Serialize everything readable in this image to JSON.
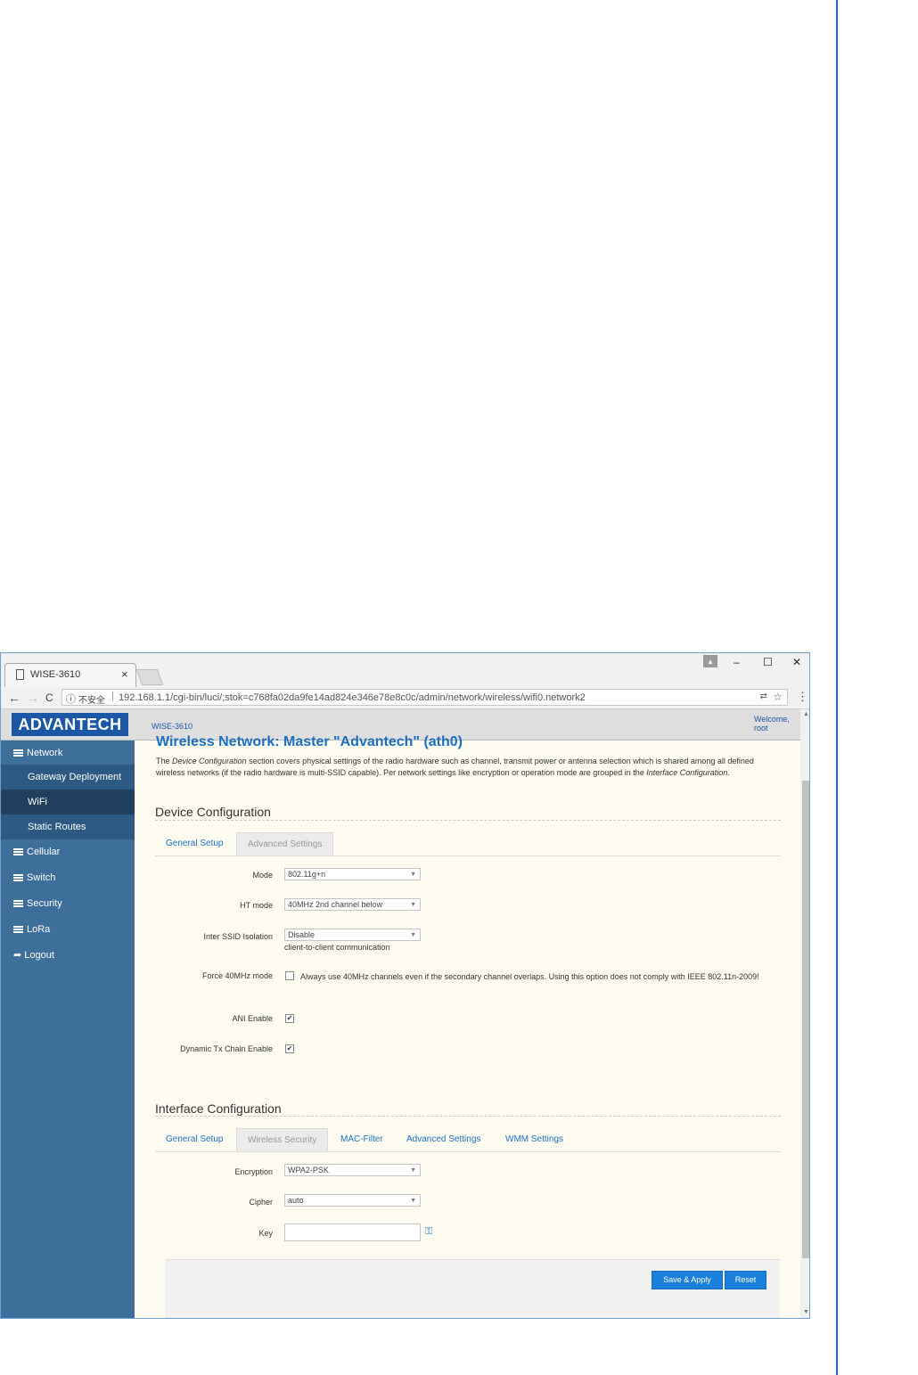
{
  "browser": {
    "tab_title": "WISE-3610",
    "tab_close": "×",
    "window_controls": {
      "minimize": "–",
      "maximize": "☐",
      "close": "✕"
    },
    "nav": {
      "back": "←",
      "forward": "→",
      "reload": "C"
    },
    "security_label": "不安全",
    "url": "192.168.1.1/cgi-bin/luci/;stok=c768fa02da9fe14ad824e346e78e8c0c/admin/network/wireless/wifi0.network2",
    "icons": [
      "page-icon",
      "info-icon",
      "translate-icon",
      "star-icon",
      "menu-icon",
      "profile-icon"
    ]
  },
  "header": {
    "logo": "ADVANTECH",
    "device": "WISE-3610",
    "welcome_line1": "Welcome,",
    "welcome_line2": "root"
  },
  "sidebar": {
    "items": [
      {
        "label": "Network",
        "type": "parent"
      },
      {
        "label": "Gateway Deployment",
        "type": "child"
      },
      {
        "label": "WiFi",
        "type": "child-active"
      },
      {
        "label": "Static Routes",
        "type": "child"
      },
      {
        "label": "Cellular",
        "type": "parent"
      },
      {
        "label": "Switch",
        "type": "parent"
      },
      {
        "label": "Security",
        "type": "parent"
      },
      {
        "label": "LoRa",
        "type": "parent"
      },
      {
        "label": "Logout",
        "type": "logout"
      }
    ]
  },
  "main": {
    "title": "Wireless Network: Master \"Advantech\" (ath0)",
    "description_parts": [
      "The ",
      "Device Configuration",
      " section covers physical settings of the radio hardware such as channel, transmit power or antenna selection which is shared among all defined wireless networks (if the radio hardware is multi-SSID capable). Per network settings like encryption or operation mode are grouped in the ",
      "Interface Configuration",
      "."
    ],
    "device_config": {
      "heading": "Device Configuration",
      "tabs": [
        "General Setup",
        "Advanced Settings"
      ],
      "fields": {
        "mode": {
          "label": "Mode",
          "value": "802.11g+n"
        },
        "ht_mode": {
          "label": "HT mode",
          "value": "40MHz 2nd channel below"
        },
        "isolation": {
          "label": "Inter SSID Isolation",
          "value": "Disable",
          "hint": "client-to-client communication"
        },
        "force40": {
          "label": "Force 40MHz mode",
          "checked": false,
          "text": "Always use 40MHz channels even if the secondary channel overlaps. Using this option does not comply with IEEE 802.11n-2009!"
        },
        "ani": {
          "label": "ANI Enable",
          "checked": true
        },
        "dyn_tx": {
          "label": "Dynamic Tx Chain Enable",
          "checked": true
        }
      }
    },
    "interface_config": {
      "heading": "Interface Configuration",
      "tabs": [
        "General Setup",
        "Wireless Security",
        "MAC-Filter",
        "Advanced Settings",
        "WMM Settings"
      ],
      "fields": {
        "encryption": {
          "label": "Encryption",
          "value": "WPA2-PSK"
        },
        "cipher": {
          "label": "Cipher",
          "value": "auto"
        },
        "key": {
          "label": "Key",
          "value": ""
        }
      }
    },
    "buttons": {
      "save_apply": "Save & Apply",
      "reset": "Reset"
    }
  },
  "colors": {
    "accent": "#1b6fc2",
    "sidebar": "#3e6f9a",
    "content_bg": "#fefcf1",
    "button": "#1b7fdc"
  }
}
